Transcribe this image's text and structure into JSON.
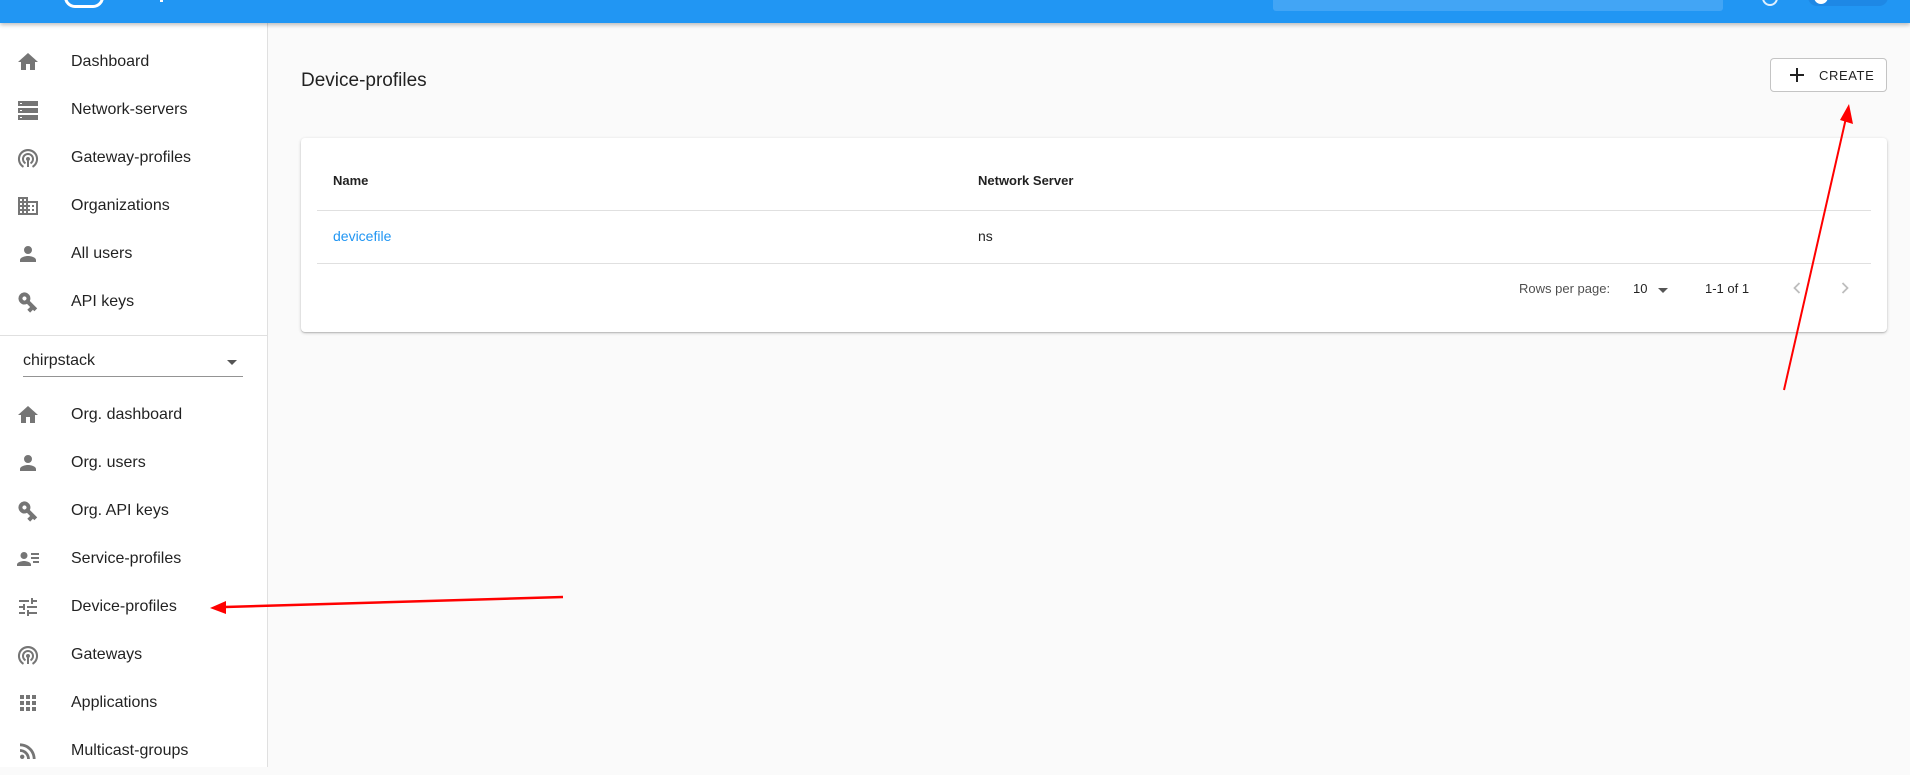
{
  "colors": {
    "primary": "#2196f3",
    "link": "#2196f3",
    "annotation": "#ff0000",
    "icon": "#757575"
  },
  "sidebar": {
    "admin_items": [
      {
        "label": "Dashboard",
        "icon": "home-icon"
      },
      {
        "label": "Network-servers",
        "icon": "server-icon"
      },
      {
        "label": "Gateway-profiles",
        "icon": "antenna-icon"
      },
      {
        "label": "Organizations",
        "icon": "domain-icon"
      },
      {
        "label": "All users",
        "icon": "person-icon"
      },
      {
        "label": "API keys",
        "icon": "key-icon"
      }
    ],
    "org_selector": {
      "value": "chirpstack"
    },
    "org_items": [
      {
        "label": "Org. dashboard",
        "icon": "home-icon"
      },
      {
        "label": "Org. users",
        "icon": "person-icon"
      },
      {
        "label": "Org. API keys",
        "icon": "key-icon"
      },
      {
        "label": "Service-profiles",
        "icon": "account-details-icon"
      },
      {
        "label": "Device-profiles",
        "icon": "tune-icon"
      },
      {
        "label": "Gateways",
        "icon": "antenna-icon"
      },
      {
        "label": "Applications",
        "icon": "apps-icon"
      },
      {
        "label": "Multicast-groups",
        "icon": "rss-icon"
      }
    ]
  },
  "main": {
    "title": "Device-profiles",
    "create_label": "CREATE",
    "table": {
      "columns": [
        "Name",
        "Network Server"
      ],
      "rows": [
        {
          "name": "devicefile",
          "network_server": "ns"
        }
      ]
    },
    "pagination": {
      "rows_per_page_label": "Rows per page:",
      "rows_per_page": "10",
      "range": "1-1 of 1"
    }
  }
}
